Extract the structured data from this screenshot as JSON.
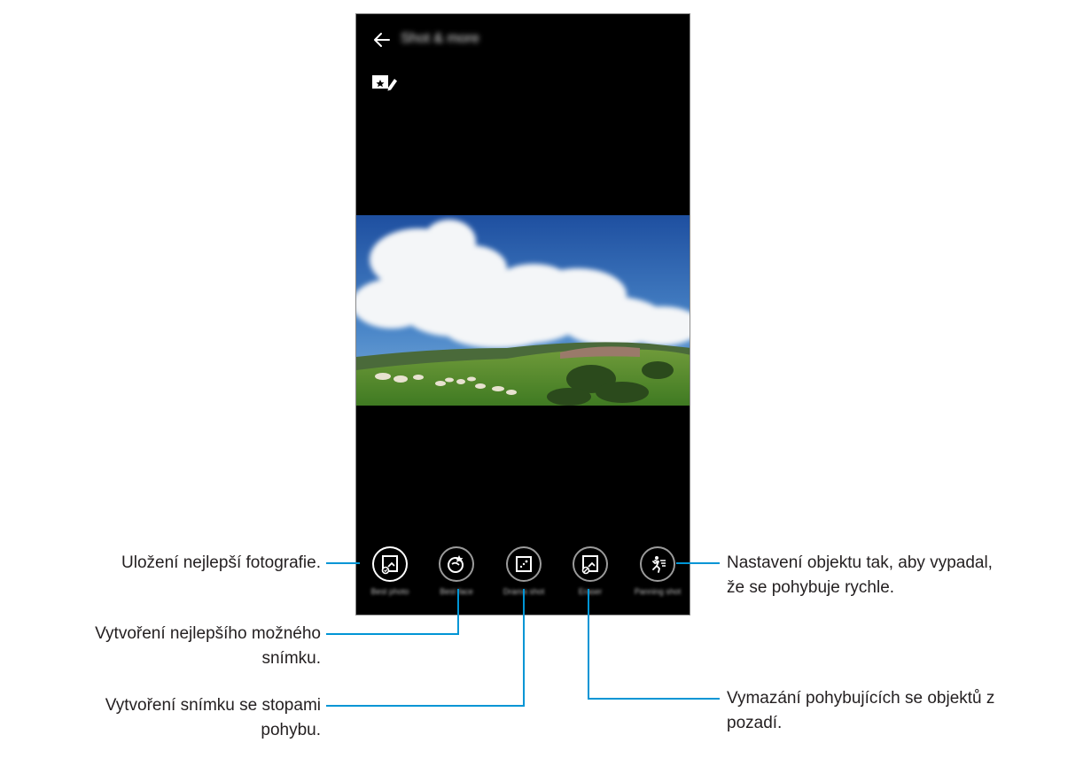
{
  "app": {
    "title": "Shot & more"
  },
  "toolbar": {
    "back_icon": "arrow-left-icon",
    "edit_icon": "favorite-edit-icon"
  },
  "modes": [
    {
      "label": "Best photo",
      "icon": "best-photo-icon",
      "selected": true
    },
    {
      "label": "Best face",
      "icon": "best-face-icon",
      "selected": false
    },
    {
      "label": "Drama shot",
      "icon": "drama-shot-icon",
      "selected": false
    },
    {
      "label": "Eraser",
      "icon": "eraser-icon",
      "selected": false
    },
    {
      "label": "Panning shot",
      "icon": "panning-shot-icon",
      "selected": false
    }
  ],
  "callouts": {
    "best_photo": "Uložení nejlepší fotografie.",
    "best_face_line1": "Vytvoření nejlepšího možného",
    "best_face_line2": "snímku.",
    "drama_line1": "Vytvoření snímku se stopami",
    "drama_line2": "pohybu.",
    "panning_line1": "Nastavení objektu tak, aby vypadal,",
    "panning_line2": "že se pohybuje rychle.",
    "eraser_line1": "Vymazání pohybujících se objektů z",
    "eraser_line2": "pozadí."
  },
  "colors": {
    "callout_line": "#0095d5",
    "screen_bg": "#000000",
    "text": "#231f20"
  }
}
